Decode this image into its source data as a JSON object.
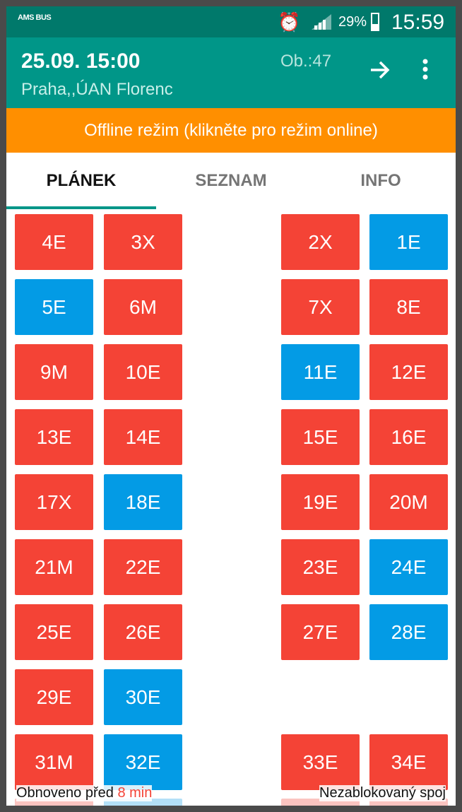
{
  "status_bar": {
    "logo": "AMS BUS",
    "battery": "29%",
    "time": "15:59"
  },
  "header": {
    "datetime": "25.09. 15:00",
    "station": "Praha,,ÚAN Florenc",
    "occupancy": "Ob.:47",
    "forward_icon": "arrow-right-icon",
    "menu_icon": "more-vert-icon"
  },
  "offline_banner": "Offline režim (klikněte pro režim online)",
  "tabs": [
    {
      "label": "PLÁNEK",
      "active": true
    },
    {
      "label": "SEZNAM",
      "active": false
    },
    {
      "label": "INFO",
      "active": false
    }
  ],
  "colors": {
    "occupied": "#f44336",
    "free": "#039be5",
    "accent": "#009688",
    "offline": "#ff8f00"
  },
  "seats": [
    {
      "label": "4E",
      "col": 0,
      "row": 0,
      "status": "red"
    },
    {
      "label": "3X",
      "col": 1,
      "row": 0,
      "status": "red"
    },
    {
      "label": "2X",
      "col": 2,
      "row": 0,
      "status": "red"
    },
    {
      "label": "1E",
      "col": 3,
      "row": 0,
      "status": "blue"
    },
    {
      "label": "5E",
      "col": 0,
      "row": 1,
      "status": "blue"
    },
    {
      "label": "6M",
      "col": 1,
      "row": 1,
      "status": "red"
    },
    {
      "label": "7X",
      "col": 2,
      "row": 1,
      "status": "red"
    },
    {
      "label": "8E",
      "col": 3,
      "row": 1,
      "status": "red"
    },
    {
      "label": "9M",
      "col": 0,
      "row": 2,
      "status": "red"
    },
    {
      "label": "10E",
      "col": 1,
      "row": 2,
      "status": "red"
    },
    {
      "label": "11E",
      "col": 2,
      "row": 2,
      "status": "blue"
    },
    {
      "label": "12E",
      "col": 3,
      "row": 2,
      "status": "red"
    },
    {
      "label": "13E",
      "col": 0,
      "row": 3,
      "status": "red"
    },
    {
      "label": "14E",
      "col": 1,
      "row": 3,
      "status": "red"
    },
    {
      "label": "15E",
      "col": 2,
      "row": 3,
      "status": "red"
    },
    {
      "label": "16E",
      "col": 3,
      "row": 3,
      "status": "red"
    },
    {
      "label": "17X",
      "col": 0,
      "row": 4,
      "status": "red"
    },
    {
      "label": "18E",
      "col": 1,
      "row": 4,
      "status": "blue"
    },
    {
      "label": "19E",
      "col": 2,
      "row": 4,
      "status": "red"
    },
    {
      "label": "20M",
      "col": 3,
      "row": 4,
      "status": "red"
    },
    {
      "label": "21M",
      "col": 0,
      "row": 5,
      "status": "red"
    },
    {
      "label": "22E",
      "col": 1,
      "row": 5,
      "status": "red"
    },
    {
      "label": "23E",
      "col": 2,
      "row": 5,
      "status": "red"
    },
    {
      "label": "24E",
      "col": 3,
      "row": 5,
      "status": "blue"
    },
    {
      "label": "25E",
      "col": 0,
      "row": 6,
      "status": "red"
    },
    {
      "label": "26E",
      "col": 1,
      "row": 6,
      "status": "red"
    },
    {
      "label": "27E",
      "col": 2,
      "row": 6,
      "status": "red"
    },
    {
      "label": "28E",
      "col": 3,
      "row": 6,
      "status": "blue"
    },
    {
      "label": "29E",
      "col": 0,
      "row": 7,
      "status": "red"
    },
    {
      "label": "30E",
      "col": 1,
      "row": 7,
      "status": "blue"
    },
    {
      "label": "31M",
      "col": 0,
      "row": 8,
      "status": "red"
    },
    {
      "label": "32E",
      "col": 1,
      "row": 8,
      "status": "blue"
    },
    {
      "label": "33E",
      "col": 2,
      "row": 8,
      "status": "red"
    },
    {
      "label": "34E",
      "col": 3,
      "row": 8,
      "status": "red"
    }
  ],
  "partial_next_row": [
    {
      "col": 0,
      "status": "red"
    },
    {
      "col": 1,
      "status": "blue"
    },
    {
      "col": 2,
      "status": "red"
    },
    {
      "col": 3,
      "status": "red"
    }
  ],
  "footer": {
    "updated_prefix": "Obnoveno před",
    "updated_minutes": "8 min",
    "legend": "Nezablokovaný spoj"
  }
}
